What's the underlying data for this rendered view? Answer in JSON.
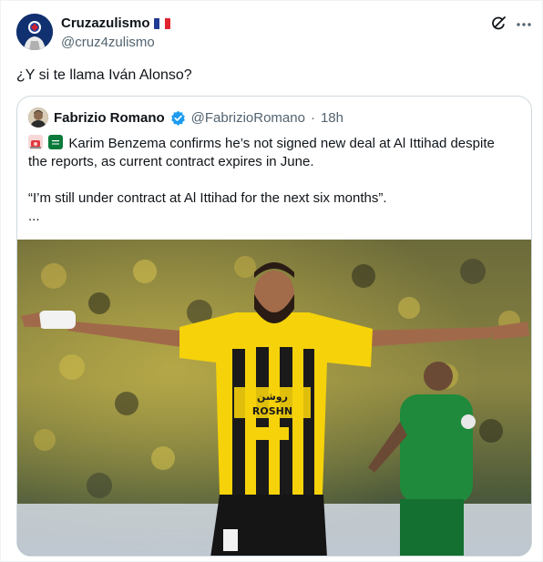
{
  "tweet": {
    "author_name": "Cruzazulismo",
    "author_handle": "@cruz4zulismo",
    "author_flag": "france-flag",
    "text": "¿Y si te llama Iván Alonso?"
  },
  "quoted_tweet": {
    "author_name": "Fabrizio Romano",
    "verified": true,
    "author_handle": "@FabrizioRomano",
    "separator": "·",
    "time": "18h",
    "line_1": "Karim Benzema confirms he’s not signed new deal at Al Ittihad despite",
    "line_2": "the reports, as current contract expires in June.",
    "line_3": "“I’m still under contract at Al Ittihad for the next six months”.",
    "line_4": "...",
    "emojis": [
      "siren-emoji",
      "saudi-arabia-flag"
    ],
    "media_alt": "Footballer in yellow and black striped jersey celebrating with arms outstretched in a stadium"
  },
  "colors": {
    "text": "#0f1419",
    "secondary": "#536471",
    "border": "#cfd9de",
    "verified": "#1d9bf0",
    "jersey_yellow": "#f5d20a"
  },
  "icons": [
    "grok-icon",
    "more-icon",
    "verified-badge-icon"
  ]
}
